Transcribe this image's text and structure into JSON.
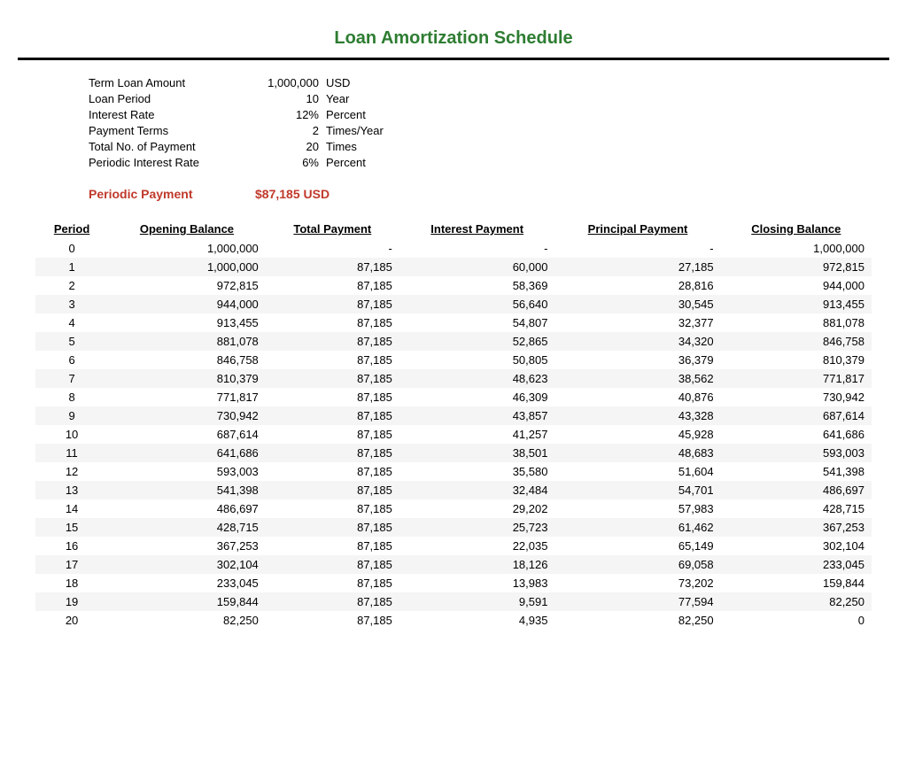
{
  "title": "Loan Amortization Schedule",
  "info": {
    "rows": [
      {
        "label": "Term Loan Amount",
        "value": "1,000,000",
        "unit": "USD"
      },
      {
        "label": "Loan Period",
        "value": "10",
        "unit": "Year"
      },
      {
        "label": "Interest Rate",
        "value": "12%",
        "unit": "Percent"
      },
      {
        "label": "Payment Terms",
        "value": "2",
        "unit": "Times/Year"
      },
      {
        "label": "Total No. of Payment",
        "value": "20",
        "unit": "Times"
      },
      {
        "label": "Periodic Interest Rate",
        "value": "6%",
        "unit": "Percent"
      }
    ]
  },
  "periodic_payment": {
    "label": "Periodic Payment",
    "value": "$87,185",
    "unit": "USD"
  },
  "table": {
    "headers": [
      "Period",
      "Opening Balance",
      "Total Payment",
      "Interest Payment",
      "Principal Payment",
      "Closing Balance"
    ],
    "rows": [
      [
        "0",
        "1,000,000",
        "-",
        "-",
        "-",
        "1,000,000"
      ],
      [
        "1",
        "1,000,000",
        "87,185",
        "60,000",
        "27,185",
        "972,815"
      ],
      [
        "2",
        "972,815",
        "87,185",
        "58,369",
        "28,816",
        "944,000"
      ],
      [
        "3",
        "944,000",
        "87,185",
        "56,640",
        "30,545",
        "913,455"
      ],
      [
        "4",
        "913,455",
        "87,185",
        "54,807",
        "32,377",
        "881,078"
      ],
      [
        "5",
        "881,078",
        "87,185",
        "52,865",
        "34,320",
        "846,758"
      ],
      [
        "6",
        "846,758",
        "87,185",
        "50,805",
        "36,379",
        "810,379"
      ],
      [
        "7",
        "810,379",
        "87,185",
        "48,623",
        "38,562",
        "771,817"
      ],
      [
        "8",
        "771,817",
        "87,185",
        "46,309",
        "40,876",
        "730,942"
      ],
      [
        "9",
        "730,942",
        "87,185",
        "43,857",
        "43,328",
        "687,614"
      ],
      [
        "10",
        "687,614",
        "87,185",
        "41,257",
        "45,928",
        "641,686"
      ],
      [
        "11",
        "641,686",
        "87,185",
        "38,501",
        "48,683",
        "593,003"
      ],
      [
        "12",
        "593,003",
        "87,185",
        "35,580",
        "51,604",
        "541,398"
      ],
      [
        "13",
        "541,398",
        "87,185",
        "32,484",
        "54,701",
        "486,697"
      ],
      [
        "14",
        "486,697",
        "87,185",
        "29,202",
        "57,983",
        "428,715"
      ],
      [
        "15",
        "428,715",
        "87,185",
        "25,723",
        "61,462",
        "367,253"
      ],
      [
        "16",
        "367,253",
        "87,185",
        "22,035",
        "65,149",
        "302,104"
      ],
      [
        "17",
        "302,104",
        "87,185",
        "18,126",
        "69,058",
        "233,045"
      ],
      [
        "18",
        "233,045",
        "87,185",
        "13,983",
        "73,202",
        "159,844"
      ],
      [
        "19",
        "159,844",
        "87,185",
        "9,591",
        "77,594",
        "82,250"
      ],
      [
        "20",
        "82,250",
        "87,185",
        "4,935",
        "82,250",
        "0"
      ]
    ]
  }
}
